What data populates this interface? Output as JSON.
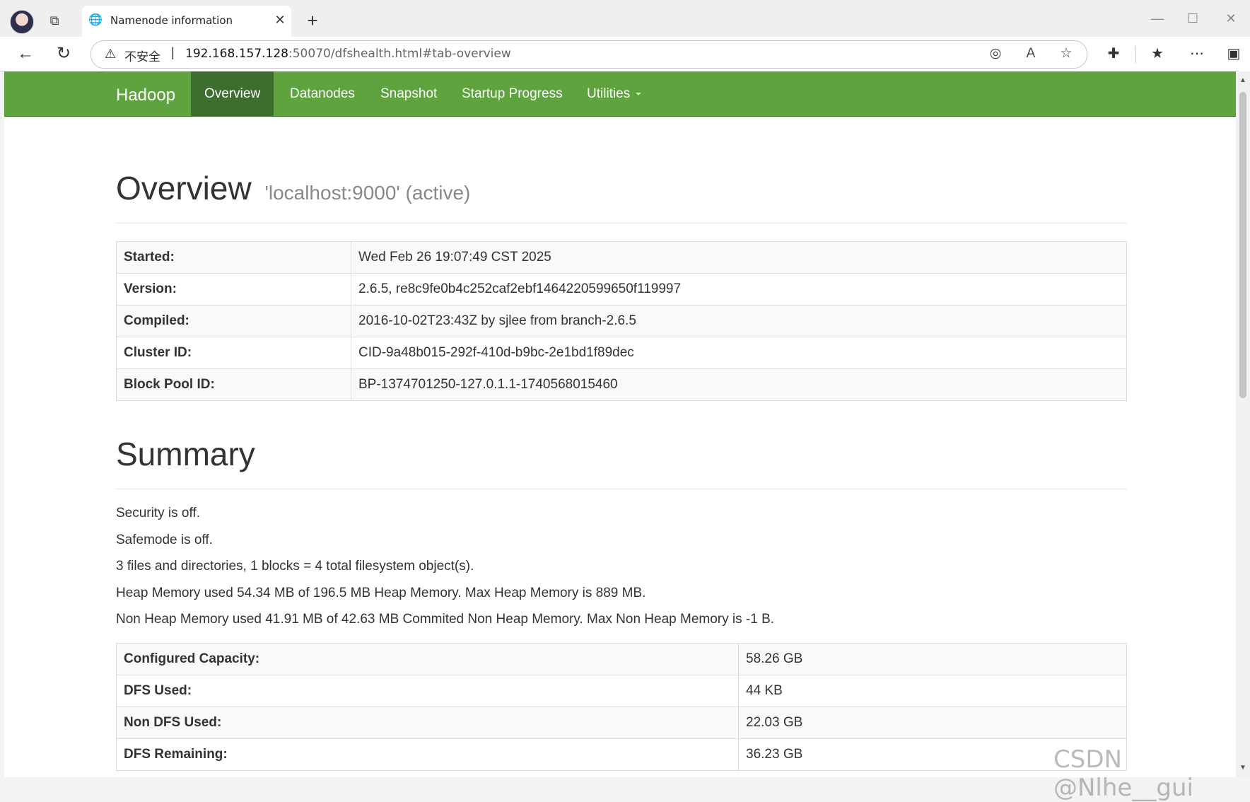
{
  "browser": {
    "tab_title": "Namenode information",
    "address_insecure_label": "不安全",
    "address_separator": "|",
    "url_host": "192.168.157.128",
    "url_rest": ":50070/dfshealth.html#tab-overview"
  },
  "navbar": {
    "brand": "Hadoop",
    "items": [
      {
        "label": "Overview",
        "active": true
      },
      {
        "label": "Datanodes"
      },
      {
        "label": "Snapshot"
      },
      {
        "label": "Startup Progress"
      },
      {
        "label": "Utilities"
      }
    ]
  },
  "overview": {
    "title": "Overview",
    "subtitle": "'localhost:9000' (active)",
    "rows": [
      {
        "key": "Started:",
        "value": "Wed Feb 26 19:07:49 CST 2025"
      },
      {
        "key": "Version:",
        "value": "2.6.5, re8c9fe0b4c252caf2ebf1464220599650f119997"
      },
      {
        "key": "Compiled:",
        "value": "2016-10-02T23:43Z by sjlee from branch-2.6.5"
      },
      {
        "key": "Cluster ID:",
        "value": "CID-9a48b015-292f-410d-b9bc-2e1bd1f89dec"
      },
      {
        "key": "Block Pool ID:",
        "value": "BP-1374701250-127.0.1.1-1740568015460"
      }
    ]
  },
  "summary": {
    "title": "Summary",
    "lines": [
      "Security is off.",
      "Safemode is off.",
      "3 files and directories, 1 blocks = 4 total filesystem object(s).",
      "Heap Memory used 54.34 MB of 196.5 MB Heap Memory. Max Heap Memory is 889 MB.",
      "Non Heap Memory used 41.91 MB of 42.63 MB Commited Non Heap Memory. Max Non Heap Memory is -1 B."
    ],
    "rows": [
      {
        "key": "Configured Capacity:",
        "value": "58.26 GB"
      },
      {
        "key": "DFS Used:",
        "value": "44 KB"
      },
      {
        "key": "Non DFS Used:",
        "value": "22.03 GB"
      },
      {
        "key": "DFS Remaining:",
        "value": "36.23 GB"
      }
    ]
  },
  "watermark": "CSDN @Nlhe__gui"
}
